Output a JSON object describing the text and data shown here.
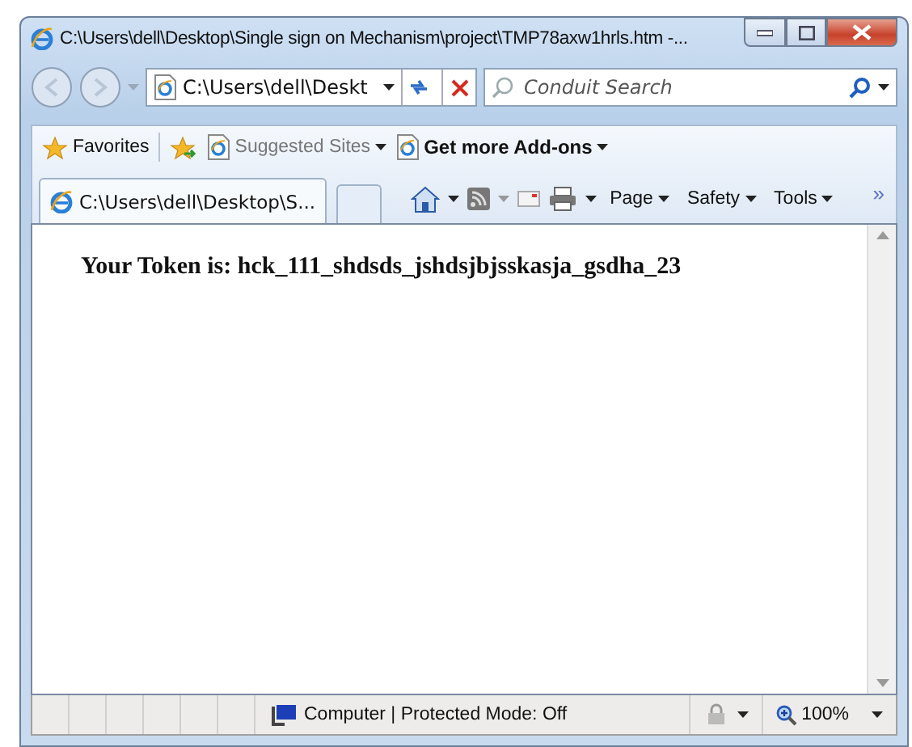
{
  "window": {
    "title": "C:\\Users\\dell\\Desktop\\Single sign on Mechanism\\project\\TMP78axw1hrls.htm -..."
  },
  "address_bar": {
    "value": "C:\\Users\\dell\\Deskt"
  },
  "search": {
    "placeholder": "Conduit Search"
  },
  "favorites_bar": {
    "favorites": "Favorites",
    "items": [
      {
        "label": "Suggested Sites",
        "kind": "faded"
      },
      {
        "label": "Get more Add-ons",
        "kind": "bold"
      }
    ]
  },
  "tabs": [
    {
      "label": "C:\\Users\\dell\\Desktop\\S...",
      "selected": true
    }
  ],
  "command_bar": {
    "menus": [
      "Page",
      "Safety",
      "Tools"
    ],
    "overflow": "»"
  },
  "content": {
    "label": "Your Token is:",
    "token": "hck_111_shdsds_jshdsjbjsskasja_gsdha_23"
  },
  "status_bar": {
    "zone": "Computer | Protected Mode: Off",
    "zoom": "100%"
  }
}
